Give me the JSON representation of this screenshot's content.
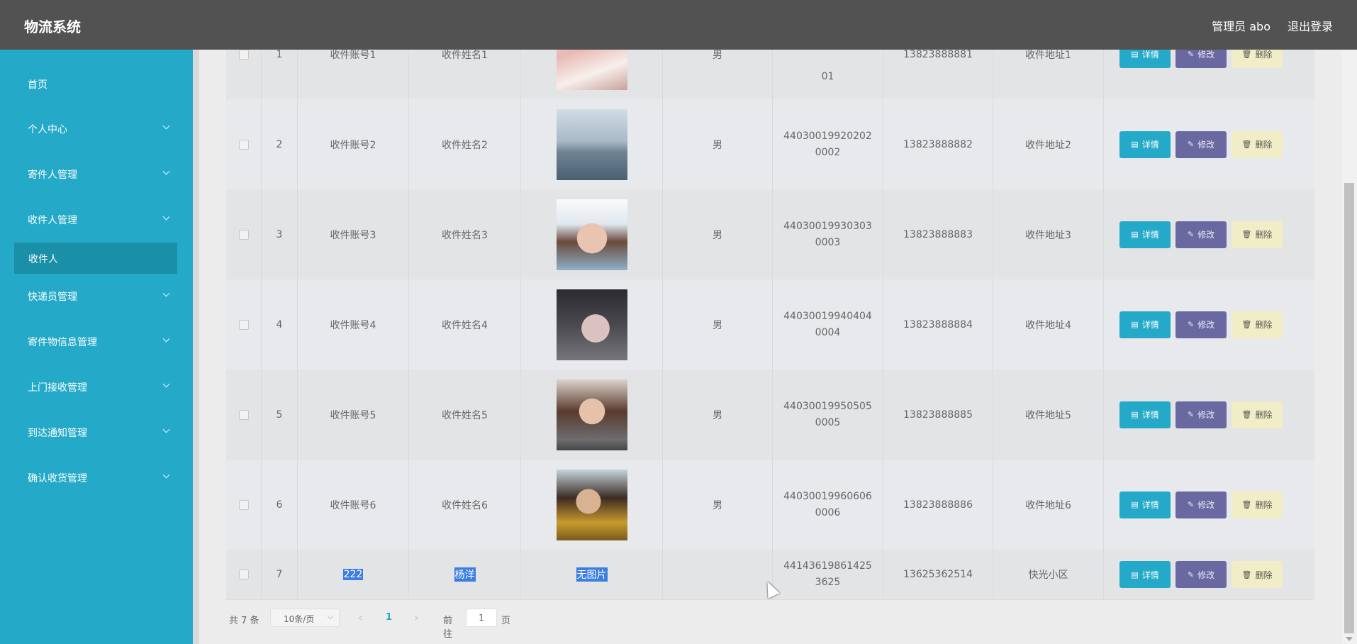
{
  "header": {
    "title": "物流系统",
    "admin": "管理员 abo",
    "logout": "退出登录"
  },
  "sidebar": {
    "items": [
      {
        "label": "首页",
        "chevron": false
      },
      {
        "label": "个人中心",
        "chevron": true
      },
      {
        "label": "寄件人管理",
        "chevron": true
      },
      {
        "label": "收件人管理",
        "chevron": true
      },
      {
        "label": "收件人",
        "active": true
      },
      {
        "label": "快递员管理",
        "chevron": true
      },
      {
        "label": "寄件物信息管理",
        "chevron": true
      },
      {
        "label": "上门接收管理",
        "chevron": true
      },
      {
        "label": "到达通知管理",
        "chevron": true
      },
      {
        "label": "确认收货管理",
        "chevron": true
      }
    ]
  },
  "table": {
    "rows": [
      {
        "idx": "1",
        "account": "收件账号1",
        "name": "收件姓名1",
        "photo": "woman-photo",
        "sex": "男",
        "idcard": "01",
        "phone": "13823888881",
        "address": "收件地址1"
      },
      {
        "idx": "2",
        "account": "收件账号2",
        "name": "收件姓名2",
        "photo": "woman-photo",
        "sex": "男",
        "idcard": "440300199202020002",
        "phone": "13823888882",
        "address": "收件地址2"
      },
      {
        "idx": "3",
        "account": "收件账号3",
        "name": "收件姓名3",
        "photo": "woman-photo",
        "sex": "男",
        "idcard": "440300199303030003",
        "phone": "13823888883",
        "address": "收件地址3"
      },
      {
        "idx": "4",
        "account": "收件账号4",
        "name": "收件姓名4",
        "photo": "woman-photo",
        "sex": "男",
        "idcard": "440300199404040004",
        "phone": "13823888884",
        "address": "收件地址4"
      },
      {
        "idx": "5",
        "account": "收件账号5",
        "name": "收件姓名5",
        "photo": "woman-photo",
        "sex": "男",
        "idcard": "440300199505050005",
        "phone": "13823888885",
        "address": "收件地址5"
      },
      {
        "idx": "6",
        "account": "收件账号6",
        "name": "收件姓名6",
        "photo": "woman-photo",
        "sex": "男",
        "idcard": "440300199606060006",
        "phone": "13823888886",
        "address": "收件地址6"
      },
      {
        "idx": "7",
        "account": "222",
        "name": "杨洋",
        "photo_text": "无图片",
        "sex": "",
        "idcard": "441436198614253625",
        "phone": "13625362514",
        "address": "快光小区"
      }
    ],
    "actions": {
      "detail": "详情",
      "edit": "修改",
      "delete": "删除"
    }
  },
  "pagination": {
    "total": "共 7 条",
    "page_size": "10条/页",
    "current": "1",
    "goto_prefix": "前往",
    "goto_value": "1",
    "goto_suffix": "页"
  },
  "colors": {
    "accent": "#24a9c8",
    "header": "#525252",
    "edit_button": "#6a68a0",
    "delete_button": "#f1edc6",
    "selection": "#3b7de0"
  }
}
